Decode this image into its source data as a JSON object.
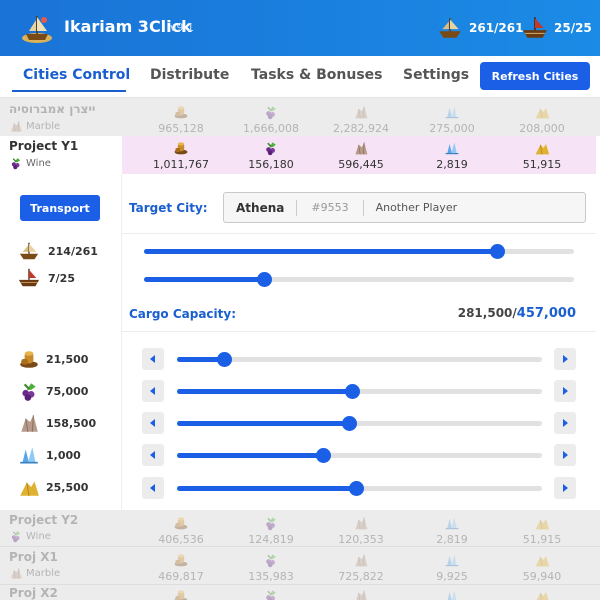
{
  "app": {
    "title": "Ikariam 3Click",
    "version": "v9.1"
  },
  "header_stats": [
    {
      "icon": "cargo-ship-icon",
      "value": "261/261"
    },
    {
      "icon": "war-ship-icon",
      "value": "25/25"
    }
  ],
  "tabs": [
    {
      "label": "Cities Control",
      "active": true
    },
    {
      "label": "Distribute",
      "active": false
    },
    {
      "label": "Tasks & Bonuses",
      "active": false
    },
    {
      "label": "Settings",
      "active": false
    }
  ],
  "refresh_label": "Refresh Cities",
  "resource_icons": [
    "wood-icon",
    "wine-icon",
    "marble-icon",
    "crystal-icon",
    "sulfur-icon"
  ],
  "cities": [
    {
      "name": "ייצרן אמברוסיה",
      "product": "Marble",
      "values": [
        "965,128",
        "1,666,008",
        "2,282,924",
        "275,000",
        "208,000"
      ],
      "selected": false
    },
    {
      "name": "Project Y1",
      "product": "Wine",
      "values": [
        "1,011,767",
        "156,180",
        "596,445",
        "2,819",
        "51,915"
      ],
      "selected": true
    },
    {
      "name": "Project Y2",
      "product": "Wine",
      "values": [
        "406,536",
        "124,819",
        "120,353",
        "2,819",
        "51,915"
      ],
      "selected": false
    },
    {
      "name": "Proj X1",
      "product": "Marble",
      "values": [
        "469,817",
        "135,983",
        "725,822",
        "9,925",
        "59,940"
      ],
      "selected": false
    },
    {
      "name": "Proj X2",
      "product": "",
      "values": [
        "",
        "",
        "",
        "",
        ""
      ],
      "selected": false
    }
  ],
  "transport": {
    "button_label": "Transport",
    "target_label": "Target City:",
    "target_city": "Athena",
    "target_id": "#9553",
    "target_player": "Another Player",
    "cargo_ships": "214/261",
    "war_ships": "7/25",
    "cargo_ships_fraction": 0.82,
    "war_ships_fraction": 0.28,
    "cargo_label": "Cargo Capacity:",
    "cargo_used": "281,500/",
    "cargo_total": "457,000",
    "resources": [
      {
        "icon": "wood-icon",
        "amount": "21,500",
        "fraction": 0.13
      },
      {
        "icon": "wine-icon",
        "amount": "75,000",
        "fraction": 0.48
      },
      {
        "icon": "marble-icon",
        "amount": "158,500",
        "fraction": 0.47
      },
      {
        "icon": "crystal-icon",
        "amount": "1,000",
        "fraction": 0.4
      },
      {
        "icon": "sulfur-icon",
        "amount": "25,500",
        "fraction": 0.49
      }
    ]
  },
  "colors": {
    "accent": "#1a5fe6",
    "selected_row": "#f6e4f6",
    "dim_row": "#ececec"
  }
}
